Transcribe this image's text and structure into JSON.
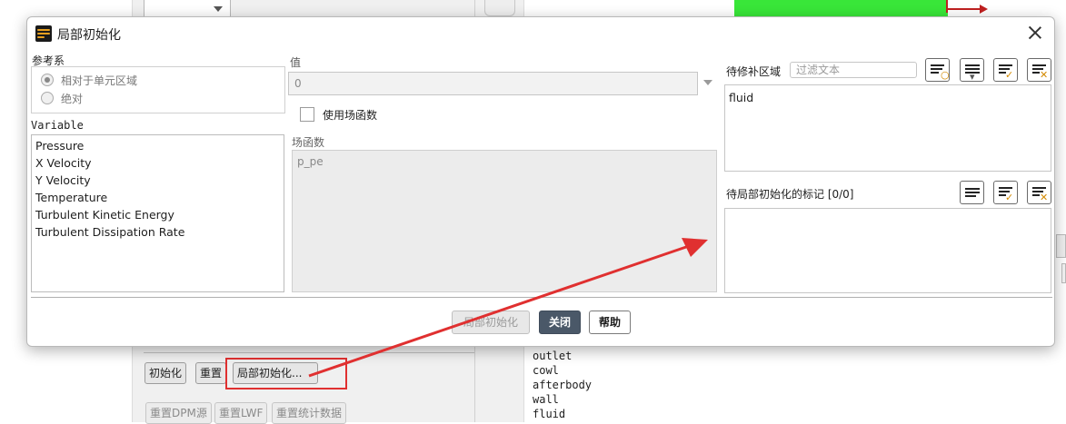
{
  "background": {
    "side_buttons": {
      "init": "初始化",
      "reset": "重置",
      "patch": "局部初始化..."
    },
    "lower_buttons": {
      "reset_dpm": "重置DPM源",
      "reset_lwf": "重置LWF",
      "reset_stats": "重置统计数据"
    },
    "zone_list": [
      "outlet",
      "cowl",
      "afterbody",
      "wall",
      "fluid"
    ]
  },
  "dialog": {
    "title": "局部初始化",
    "reference_frame": {
      "label": "参考系",
      "options": [
        {
          "label": "相对于单元区域",
          "selected": true
        },
        {
          "label": "绝对",
          "selected": false
        }
      ]
    },
    "variable": {
      "label": "Variable",
      "items": [
        "Pressure",
        "X Velocity",
        "Y Velocity",
        "Temperature",
        "Turbulent Kinetic Energy",
        "Turbulent Dissipation Rate"
      ]
    },
    "value": {
      "label": "值",
      "current": "0"
    },
    "use_field_function": {
      "label": "使用场函数",
      "checked": false
    },
    "field_function": {
      "label": "场函数",
      "items": [
        "p_pe"
      ]
    },
    "zones_to_patch": {
      "label": "待修补区域",
      "filter_placeholder": "过滤文本",
      "items": [
        "fluid"
      ]
    },
    "registers_to_patch": {
      "label": "待局部初始化的标记 [0/0]"
    },
    "buttons": {
      "patch": "局部初始化",
      "close": "关闭",
      "help": "帮助"
    }
  },
  "colors": {
    "accent_red": "#e03030",
    "primary_button": "#4a5868",
    "mesh_green": "#39e639"
  }
}
